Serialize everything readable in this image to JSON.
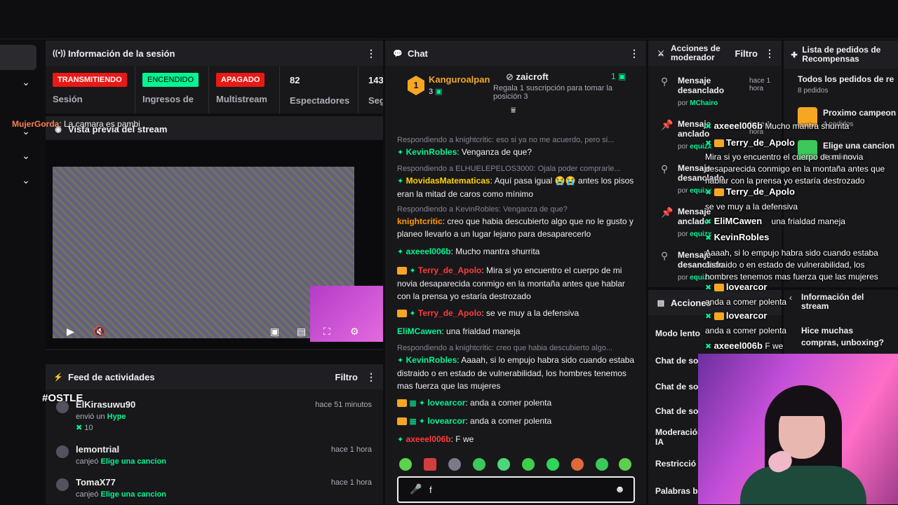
{
  "session": {
    "title": "Información de la sesión",
    "cells": [
      {
        "badge": "TRANSMITIENDO",
        "label": "Sesión"
      },
      {
        "badge": "ENCENDIDO",
        "label": "Ingresos de"
      },
      {
        "badge": "APAGADO",
        "label": "Multistream"
      },
      {
        "value": "82",
        "label": "Espectadores"
      },
      {
        "value": "143",
        "label": "Seg"
      }
    ]
  },
  "preview": {
    "title": "Vista previa del stream",
    "overlay_tag": "#OSTLE"
  },
  "feed": {
    "title": "Feed de actividades",
    "filter": "Filtro",
    "items": [
      {
        "name": "ElKirasuwu90",
        "action": "envió un",
        "target": "Hype",
        "time": "hace 51 minutos",
        "amount": "10"
      },
      {
        "name": "lemontrial",
        "action": "canjeó",
        "target": "Elige una cancion",
        "time": "hace 1 hora"
      },
      {
        "name": "TomaX77",
        "action": "canjeó",
        "target": "Elige una cancion",
        "time": "hace 1 hora"
      }
    ]
  },
  "chat": {
    "title": "Chat",
    "top_user": "Kanguroalpan",
    "top_rank": "1",
    "top_count": "3",
    "gifter": "zaicroft",
    "gift_count": "1",
    "gift_text": "Regala 1 suscripción para tomar la posición 3",
    "lines": [
      {
        "type": "msg",
        "user": "MujerGorda",
        "color": "#ff7f50",
        "text": ": La camara es pambi"
      },
      {
        "type": "reply",
        "text": "Respondiendo a knightcritic: eso si ya no me acuerdo, pero si..."
      },
      {
        "type": "msg",
        "user": "KevinRobles",
        "color": "#00f593",
        "text": ": Venganza de que?"
      },
      {
        "type": "reply",
        "text": "Respondiendo a ELHUELEPELOS3000: Ojala poder comprarle..."
      },
      {
        "type": "msg",
        "user": "MovidasMatematicas",
        "color": "#ffd400",
        "text": ": Aquí pasa igual 😭😭 antes los pisos eran la mitad de caros como mínimo"
      },
      {
        "type": "reply",
        "text": "Respondiendo a KevinRobles: Venganza de que?"
      },
      {
        "type": "msg",
        "user": "knightcritic",
        "color": "#ff9900",
        "text": ": creo que habia descubierto algo que no le gusto y planeo llevarlo a un lugar lejano para desaparecerlo"
      },
      {
        "type": "msg",
        "user": "axeeel006b",
        "color": "#00f593",
        "text": ": Mucho mantra shurrita"
      },
      {
        "type": "msg",
        "user": "Terry_de_Apolo",
        "color": "#ff3b3b",
        "text": ": Mira si yo encuentro el cuerpo de mi novia desaparecida conmigo en la montaña antes que hablar con la prensa yo estaría destrozado"
      },
      {
        "type": "msg",
        "user": "Terry_de_Apolo",
        "color": "#ff3b3b",
        "text": ": se ve muy a la defensiva"
      },
      {
        "type": "msg",
        "user": "EliMCawen",
        "color": "#00f593",
        "text": ": una frialdad maneja"
      },
      {
        "type": "reply",
        "text": "Respondiendo a knightcritic: creo que habia descubierto algo..."
      },
      {
        "type": "msg",
        "user": "KevinRobles",
        "color": "#00f593",
        "text": ": Aaaah, si lo empujo habra sido cuando estaba distraido o en estado de vulnerabilidad, los hombres tenemos mas fuerza que las mujeres"
      },
      {
        "type": "msg",
        "user": "lovearcor",
        "color": "#00f593",
        "text": ": anda a comer polenta"
      },
      {
        "type": "msg",
        "user": "lovearcor",
        "color": "#00f593",
        "text": ": anda a comer polenta"
      },
      {
        "type": "msg",
        "user": "axeeel006b",
        "color": "#ff3b3b",
        "text": ": F we"
      }
    ],
    "input_value": "f"
  },
  "moderator": {
    "title": "Acciones de moderador",
    "filter": "Filtro",
    "items": [
      {
        "title": "Mensaje desanclado",
        "time": "hace 1 hora",
        "by": "por",
        "mod": "MChairo"
      },
      {
        "title": "Mensaje anclado",
        "time": "hace 1 hora",
        "by": "por",
        "mod": "equizx"
      },
      {
        "title": "Mensaje desanclado",
        "time": "",
        "by": "por",
        "mod": "equizx"
      },
      {
        "title": "Mensaje anclado",
        "time": "",
        "by": "por",
        "mod": "equizx"
      },
      {
        "title": "Mensaje desanclado",
        "time": "",
        "by": "por",
        "mod": "equizx"
      }
    ]
  },
  "quick_actions": {
    "title": "Acciones",
    "items": [
      "Modo lento",
      "Chat de so",
      "Chat de so",
      "Chat de so",
      "Moderación IA",
      "Restricció",
      "Palabras b"
    ]
  },
  "rewards": {
    "title": "Lista de pedidos de Recompensas",
    "all_label": "Todos los pedidos de re",
    "all_count": "8 pedidos",
    "items": [
      {
        "name": "Proximo campeon",
        "count": "4 pedidos"
      },
      {
        "name": "Elige una cancion",
        "count": "4 pedidos"
      }
    ]
  },
  "stream_info": {
    "title": "Información del stream",
    "text": "Hice muchas compras, unboxing?"
  },
  "overlay_chat": [
    {
      "user": "axeeel006b",
      "text": "Mucho mantra shurrita"
    },
    {
      "user": "Terry_de_Apolo",
      "text": "Mira si yo encuentro el cuerpo de mi novia desaparecida conmigo en la montaña antes que hablar con la prensa yo estaría destrozado"
    },
    {
      "user": "Terry_de_Apolo",
      "text": "se ve muy a la defensiva"
    },
    {
      "user": "EliMCawen",
      "text": "una frialdad maneja"
    },
    {
      "user": "KevinRobles",
      "text": "Aaaah, si lo empujo habra sido cuando estaba distraido o en estado de vulnerabilidad, los hombres tenemos mas fuerza que las mujeres"
    },
    {
      "user": "lovearcor",
      "text": "anda a comer polenta"
    },
    {
      "user": "lovearcor",
      "text": "anda a comer polenta"
    },
    {
      "user": "axeeel006b",
      "text": "F we"
    }
  ]
}
